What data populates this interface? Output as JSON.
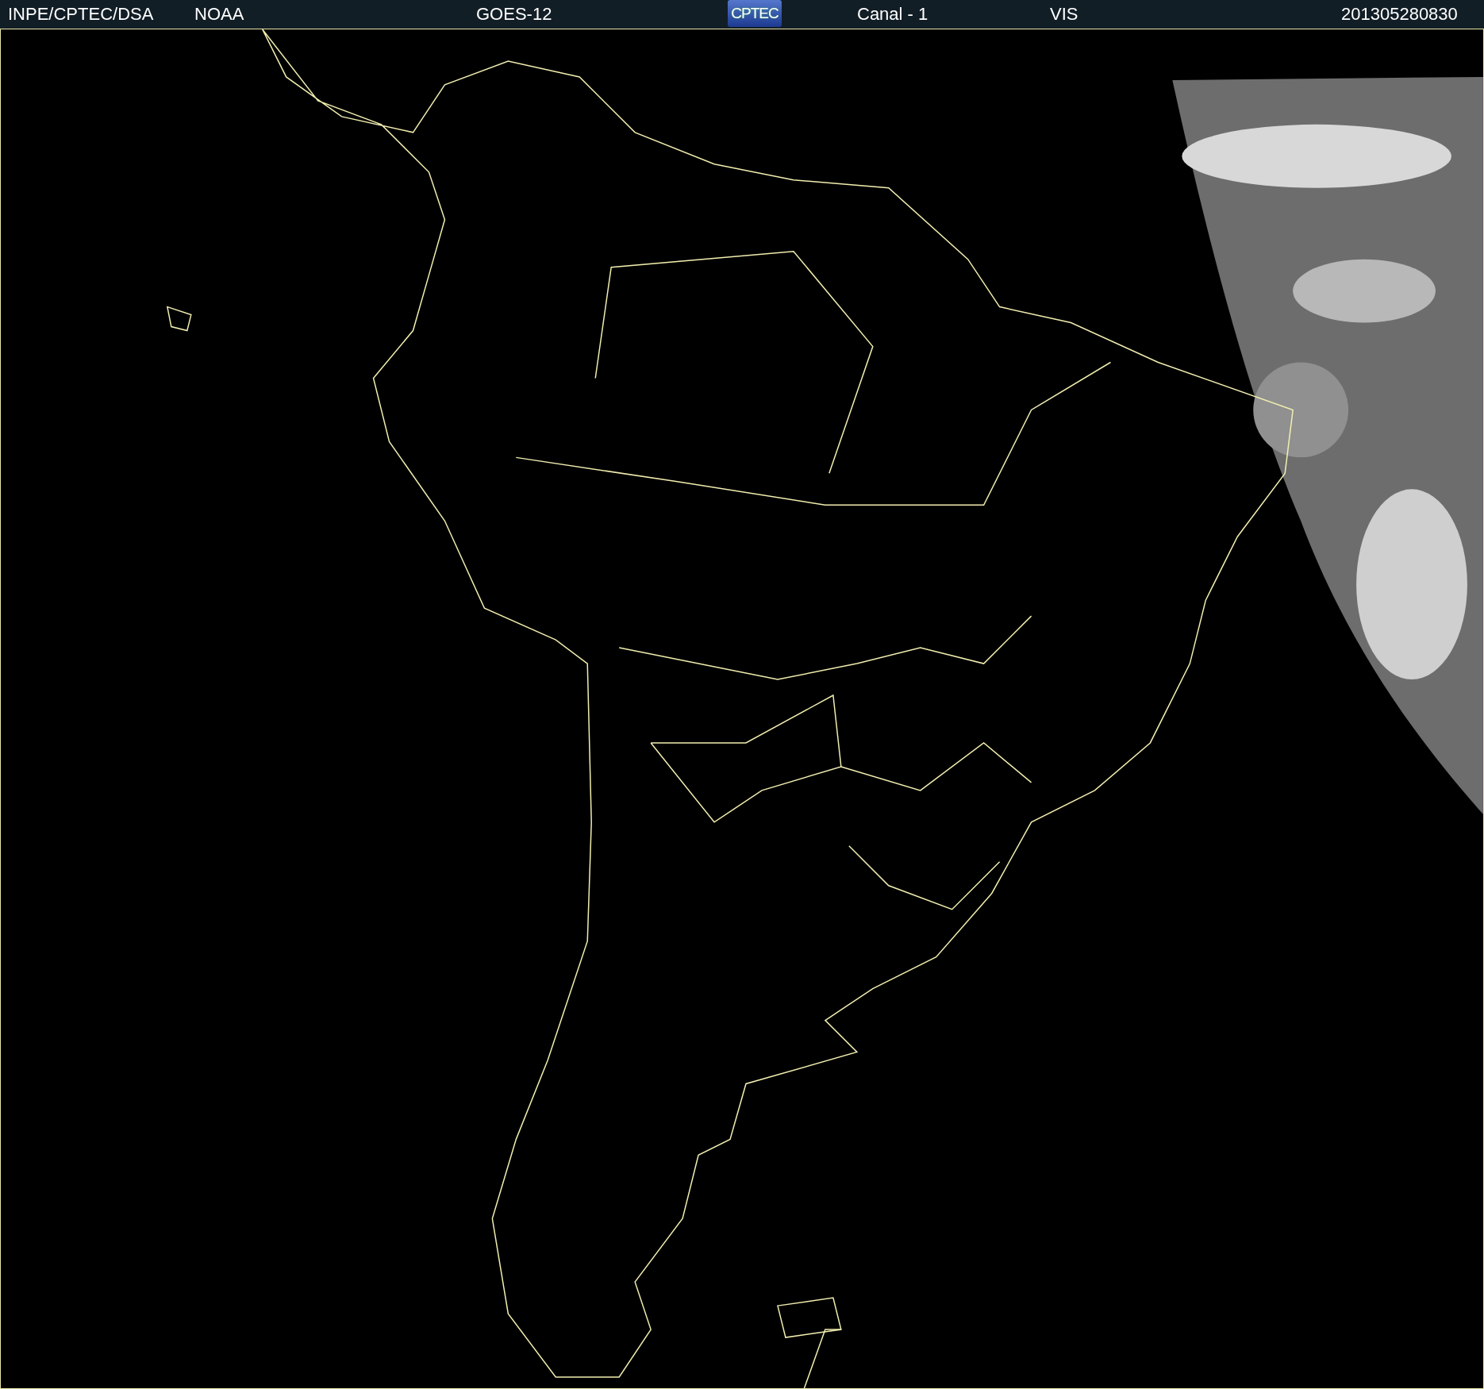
{
  "header": {
    "items": [
      {
        "kind": "text",
        "text": "INPE/CPTEC/DSA"
      },
      {
        "kind": "text",
        "text": "NOAA"
      },
      {
        "kind": "text",
        "text": "GOES-12"
      },
      {
        "kind": "logo",
        "text": "CPTEC"
      },
      {
        "kind": "text",
        "text": "Canal - 1"
      },
      {
        "kind": "text",
        "text": "VIS"
      },
      {
        "kind": "text",
        "text": "201305280830"
      }
    ]
  }
}
